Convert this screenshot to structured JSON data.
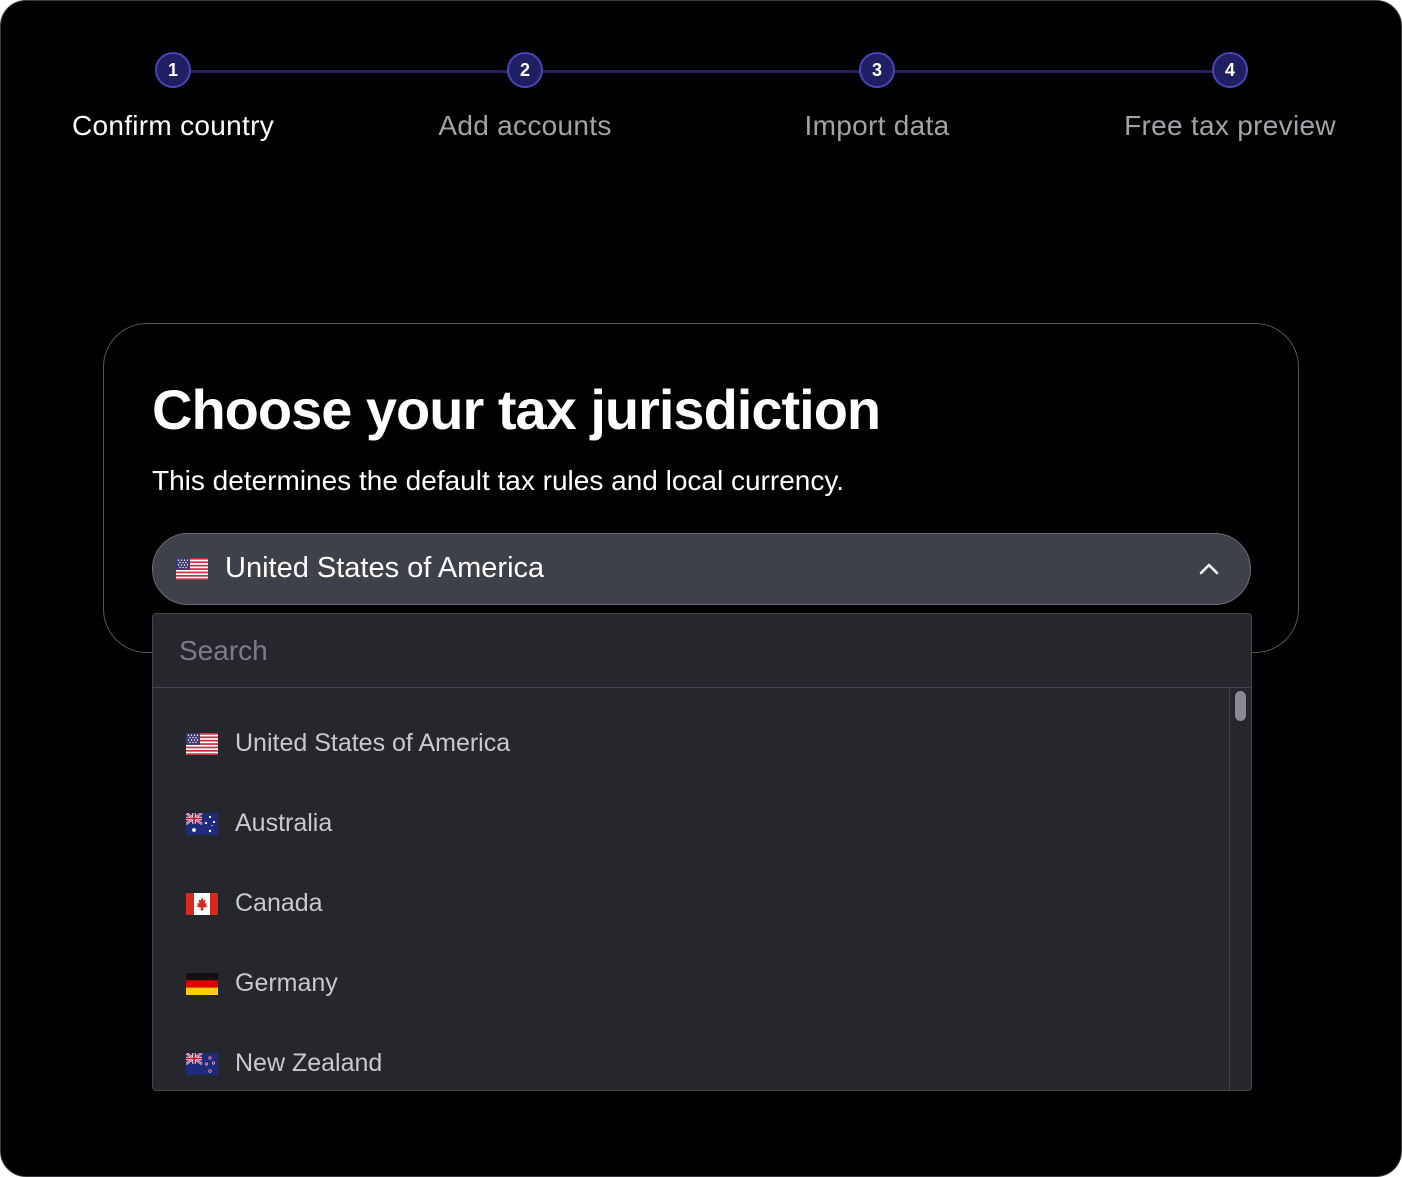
{
  "stepper": {
    "steps": [
      {
        "number": "1",
        "label": "Confirm country",
        "active": true
      },
      {
        "number": "2",
        "label": "Add accounts",
        "active": false
      },
      {
        "number": "3",
        "label": "Import data",
        "active": false
      },
      {
        "number": "4",
        "label": "Free tax preview",
        "active": false
      }
    ]
  },
  "card": {
    "title": "Choose your tax jurisdiction",
    "subtitle": "This determines the default tax rules and local currency."
  },
  "select": {
    "value": "United States of America",
    "flag_icon": "us-flag-icon",
    "expanded": true
  },
  "dropdown": {
    "search_placeholder": "Search",
    "options": [
      {
        "label": "United States of America",
        "flag_icon": "us-flag-icon"
      },
      {
        "label": "Australia",
        "flag_icon": "au-flag-icon"
      },
      {
        "label": "Canada",
        "flag_icon": "ca-flag-icon"
      },
      {
        "label": "Germany",
        "flag_icon": "de-flag-icon"
      },
      {
        "label": "New Zealand",
        "flag_icon": "nz-flag-icon"
      }
    ]
  },
  "colors": {
    "background": "#000000",
    "step_circle": "#211f63",
    "step_line": "#23215e",
    "select_bg": "#3e4149",
    "dropdown_bg": "#26272c"
  }
}
